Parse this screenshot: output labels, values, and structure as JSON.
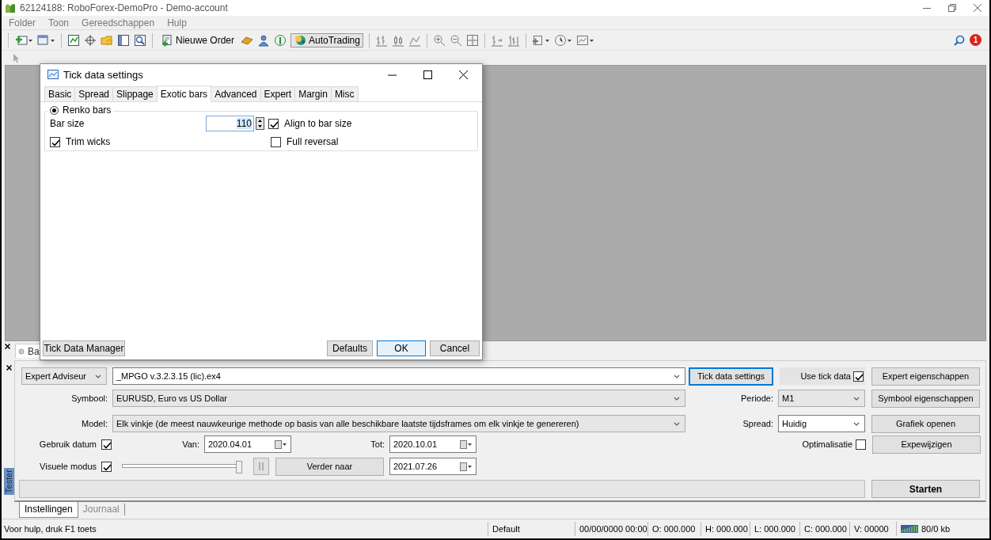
{
  "window": {
    "title": "62124188: RoboForex-DemoPro - Demo-account"
  },
  "menu": [
    "Folder",
    "Toon",
    "Gereedschappen",
    "Hulp"
  ],
  "toolbar": {
    "new_order": {
      "label": "Nieuwe Order"
    },
    "autotrading": {
      "label": "AutoTrading",
      "on": true
    },
    "notifications": {
      "count": "1"
    }
  },
  "chart_tabs": [
    {
      "label": "Ba"
    }
  ],
  "dialog": {
    "title": "Tick data settings",
    "tabs": [
      {
        "label": "Basic",
        "selected": false
      },
      {
        "label": "Spread",
        "selected": false
      },
      {
        "label": "Slippage",
        "selected": false
      },
      {
        "label": "Exotic bars",
        "selected": true
      },
      {
        "label": "Advanced",
        "selected": false
      },
      {
        "label": "Expert",
        "selected": false
      },
      {
        "label": "Margin",
        "selected": false
      },
      {
        "label": "Misc",
        "selected": false
      }
    ],
    "renko": {
      "label": "Renko bars",
      "selected": true
    },
    "bar_size": {
      "label": "Bar size",
      "value": "110"
    },
    "options": [
      {
        "label": "Align to bar size",
        "checked": true
      },
      {
        "label": "Trim wicks",
        "checked": true
      },
      {
        "label": "Full reversal",
        "checked": false
      }
    ],
    "buttons": [
      {
        "label": "Tick Data Manager",
        "default": false
      },
      {
        "label": "Defaults",
        "default": false
      },
      {
        "label": "OK",
        "default": true
      },
      {
        "label": "Cancel",
        "default": false
      }
    ]
  },
  "tester": {
    "side_label": "Tester",
    "expert_type": "Expert Adviseur",
    "expert": "_MPGO v.3.2.3.15 (lic).ex4",
    "tick_data_button": "Tick data settings",
    "use_tick_data": {
      "label": "Use tick data",
      "checked": true
    },
    "symbol": {
      "label": "Symbool:",
      "value": "EURUSD, Euro vs US Dollar"
    },
    "model": {
      "label": "Model:",
      "value": "Elk vinkje (de meest nauwkeurige methode op basis van alle beschikbare laatste tijdsframes om elk vinkje te genereren)"
    },
    "periode": {
      "label": "Periode:",
      "value": "M1"
    },
    "spread": {
      "label": "Spread:",
      "value": "Huidig"
    },
    "optimalisatie": {
      "label": "Optimalisatie",
      "checked": false
    },
    "side_buttons": [
      "Expert eigenschappen",
      "Symbool eigenschappen",
      "Grafiek openen",
      "Expewijzigen"
    ],
    "gebruik_datum": {
      "label": "Gebruik datum",
      "checked": true
    },
    "van": {
      "label": "Van:",
      "value": "2020.04.01"
    },
    "tot": {
      "label": "Tot:",
      "value": "2020.10.01"
    },
    "visuele_modus": {
      "label": "Visuele modus",
      "checked": true
    },
    "speed": {
      "level": 1
    },
    "verder_naar": "Verder naar",
    "skip_date": "2021.07.26",
    "start": "Starten",
    "tabs": [
      {
        "label": "Instellingen",
        "selected": true
      },
      {
        "label": "Journaal",
        "selected": false
      }
    ]
  },
  "status_bar": {
    "help": "Voor hulp, druk F1 toets",
    "cells": [
      "Default",
      "00/00/0000 00:00",
      "O: 000.000",
      "H: 000.000",
      "L: 000.000",
      "C: 000.000",
      "V: 00000"
    ],
    "traffic": "80/0 kb"
  }
}
